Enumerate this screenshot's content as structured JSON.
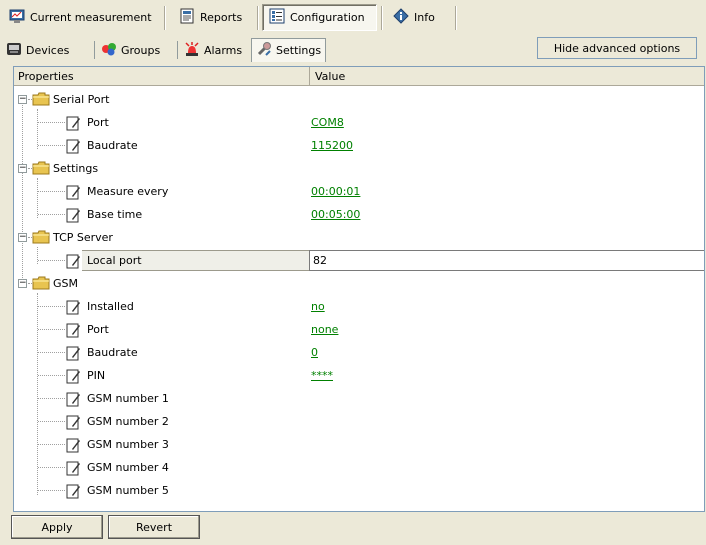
{
  "main_tabs": [
    {
      "label": "Current measurement",
      "icon": "measurement-icon",
      "active": false
    },
    {
      "label": "Reports",
      "icon": "reports-icon",
      "active": false
    },
    {
      "label": "Configuration",
      "icon": "configuration-icon",
      "active": true
    },
    {
      "label": "Info",
      "icon": "info-icon",
      "active": false
    }
  ],
  "sub_tabs": [
    {
      "label": "Devices",
      "icon": "devices-icon",
      "active": false
    },
    {
      "label": "Groups",
      "icon": "groups-icon",
      "active": false
    },
    {
      "label": "Alarms",
      "icon": "alarm-icon",
      "active": false
    },
    {
      "label": "Settings",
      "icon": "settings-icon",
      "active": true
    }
  ],
  "hide_advanced_label": "Hide advanced options",
  "grid": {
    "col_properties": "Properties",
    "col_value": "Value",
    "sections": [
      {
        "title": "Serial Port",
        "items": [
          {
            "label": "Port",
            "value": "COM8"
          },
          {
            "label": "Baudrate",
            "value": "115200"
          }
        ]
      },
      {
        "title": "Settings",
        "items": [
          {
            "label": "Measure every",
            "value": "00:00:01"
          },
          {
            "label": "Base time",
            "value": "00:05:00"
          }
        ]
      },
      {
        "title": "TCP Server",
        "items": [
          {
            "label": "Local port",
            "value": "82"
          }
        ]
      },
      {
        "title": "GSM",
        "items": [
          {
            "label": "Installed",
            "value": "no"
          },
          {
            "label": "Port",
            "value": "none"
          },
          {
            "label": "Baudrate",
            "value": "0"
          },
          {
            "label": "PIN",
            "value": "****"
          },
          {
            "label": "GSM number 1",
            "value": ""
          },
          {
            "label": "GSM number 2",
            "value": ""
          },
          {
            "label": "GSM number 3",
            "value": ""
          },
          {
            "label": "GSM number 4",
            "value": ""
          },
          {
            "label": "GSM number 5",
            "value": ""
          }
        ]
      }
    ]
  },
  "buttons": {
    "apply": "Apply",
    "revert": "Revert"
  },
  "colors": {
    "link": "#008000",
    "folder": "#e8c450",
    "background": "#ece9d8"
  }
}
